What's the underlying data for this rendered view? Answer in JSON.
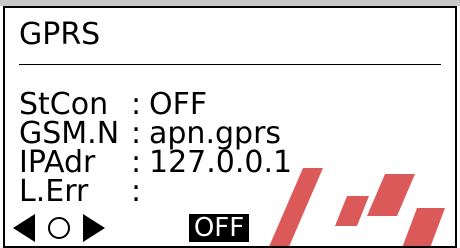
{
  "screen": {
    "title": "GPRS",
    "fields": [
      {
        "label": "StCon",
        "colon": ":",
        "value": "OFF"
      },
      {
        "label": "GSM.N",
        "colon": ":",
        "value": "apn.gprs"
      },
      {
        "label": "IPAdr",
        "colon": ":",
        "value": "127.0.0.1"
      },
      {
        "label": "L.Err",
        "colon": ":",
        "value": ""
      }
    ],
    "status_badge": "OFF"
  },
  "icons": {
    "left": "arrow-left-icon",
    "center": "circle-icon",
    "right": "arrow-right-icon"
  },
  "colors": {
    "frame": "#000000",
    "background": "#ffffff",
    "badge_bg": "#000000",
    "badge_text": "#ffffff",
    "watermark": "#d94848"
  }
}
